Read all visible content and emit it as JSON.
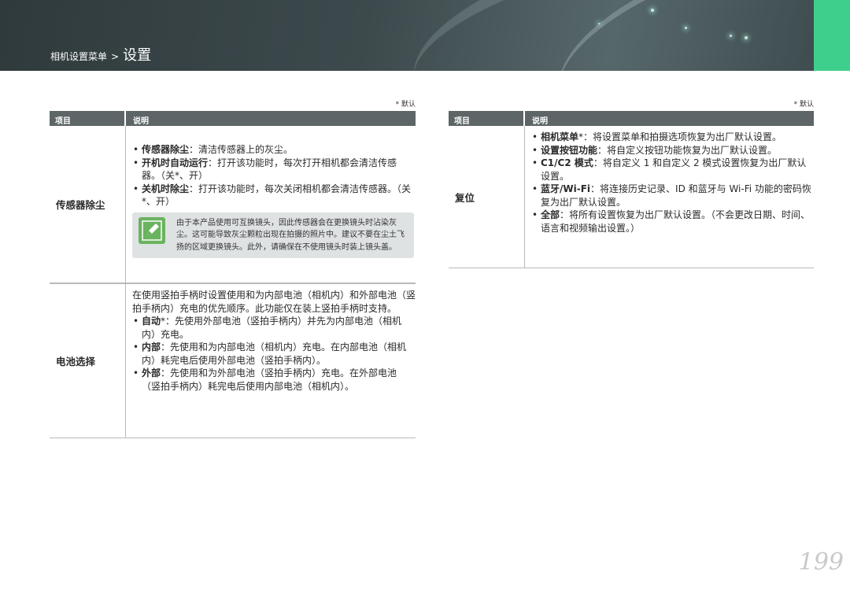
{
  "header": {
    "breadcrumb_sub": "相机设置菜单",
    "breadcrumb_sep": ">",
    "breadcrumb_current": "设置"
  },
  "left_table": {
    "default_note": "* 默认",
    "col_item": "项目",
    "col_desc": "说明",
    "rows": [
      {
        "item": "传感器除尘",
        "bullets": [
          {
            "term": "传感器除尘",
            "text": "：清洁传感器上的灰尘。"
          },
          {
            "term": "开机时自动运行",
            "text": "：打开该功能时，每次打开相机都会清洁传感器。（关*、开）"
          },
          {
            "term": "关机时除尘",
            "text": "：打开该功能时，每次关闭相机都会清洁传感器。（关*、开）"
          }
        ],
        "note": "由于本产品使用可互换镜头，因此传感器会在更换镜头时沾染灰尘。这可能导致灰尘颗粒出现在拍摄的照片中。建议不要在尘土飞扬的区域更换镜头。此外，请确保在不使用镜头时装上镜头盖。"
      },
      {
        "item": "电池选择",
        "intro": "在使用竖拍手柄时设置使用和为内部电池（相机内）和外部电池（竖拍手柄内）充电的优先顺序。此功能仅在装上竖拍手柄时支持。",
        "bullets": [
          {
            "term": "自动",
            "text": "*：先使用外部电池（竖拍手柄内）并先为内部电池（相机内）充电。"
          },
          {
            "term": "内部",
            "text": "：先使用和为内部电池（相机内）充电。在内部电池（相机内）耗完电后使用外部电池（竖拍手柄内）。"
          },
          {
            "term": "外部",
            "text": "：先使用和为外部电池（竖拍手柄内）充电。在外部电池（竖拍手柄内）耗完电后使用内部电池（相机内）。"
          }
        ]
      }
    ]
  },
  "right_table": {
    "default_note": "* 默认",
    "col_item": "项目",
    "col_desc": "说明",
    "rows": [
      {
        "item": "复位",
        "bullets": [
          {
            "term": "相机菜单",
            "text": "*：将设置菜单和拍摄选项恢复为出厂默认设置。"
          },
          {
            "term": "设置按钮功能",
            "text": "：将自定义按钮功能恢复为出厂默认设置。"
          },
          {
            "term": "C1/C2 模式",
            "text": "：将自定义 1 和自定义 2 模式设置恢复为出厂默认设置。"
          },
          {
            "term": "蓝牙/Wi-Fi",
            "text": "：将连接历史记录、ID 和蓝牙与 Wi-Fi 功能的密码恢复为出厂默认设置。"
          },
          {
            "term": "全部",
            "text": "：将所有设置恢复为出厂默认设置。（不会更改日期、时间、语言和视频输出设置。）"
          }
        ]
      }
    ]
  },
  "page_number": "199"
}
